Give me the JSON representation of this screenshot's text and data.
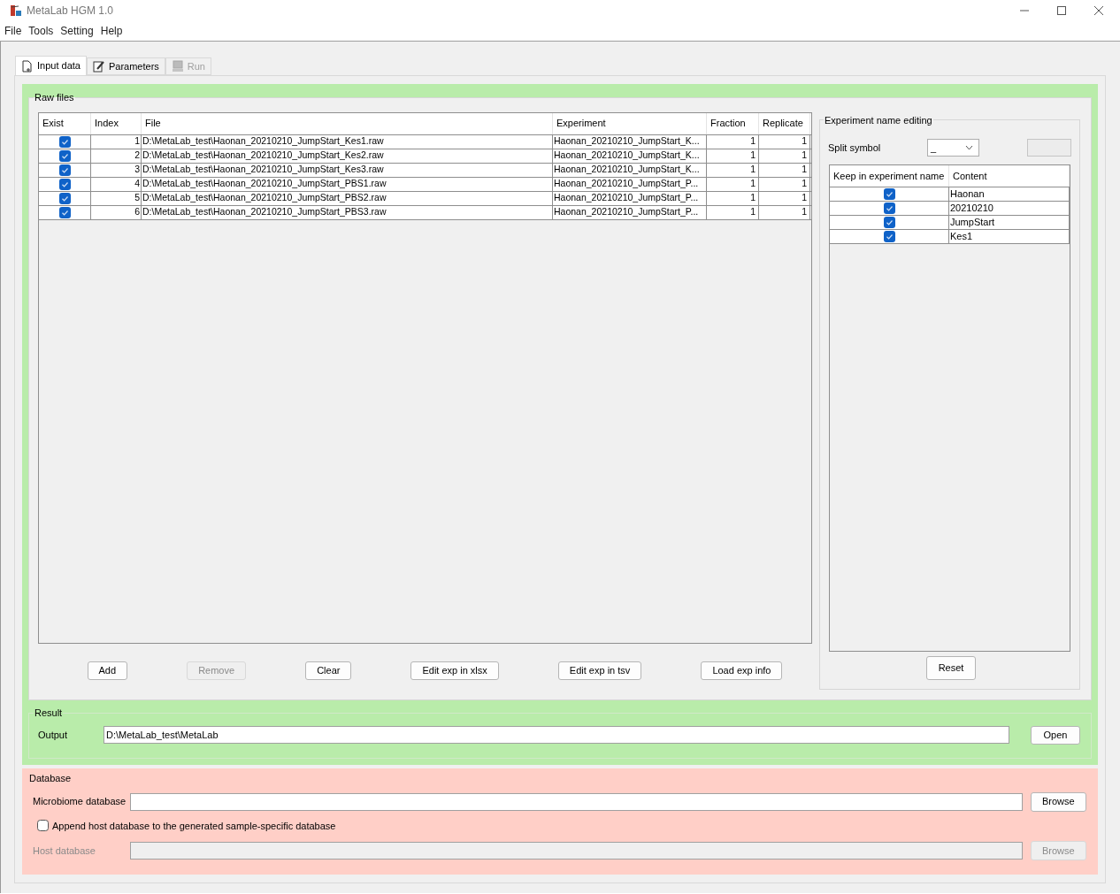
{
  "window": {
    "title": "MetaLab HGM 1.0"
  },
  "menu": [
    "File",
    "Tools",
    "Setting",
    "Help"
  ],
  "tabs": [
    {
      "label": "Input data",
      "selected": true,
      "disabled": false
    },
    {
      "label": "Parameters",
      "selected": false,
      "disabled": false
    },
    {
      "label": "Run",
      "selected": false,
      "disabled": true
    }
  ],
  "raw_files": {
    "title": "Raw files",
    "columns": [
      "Exist",
      "Index",
      "File",
      "Experiment",
      "Fraction",
      "Replicate"
    ],
    "rows": [
      {
        "exist": true,
        "index": "1",
        "file": "D:\\MetaLab_test\\Haonan_20210210_JumpStart_Kes1.raw",
        "experiment": "Haonan_20210210_JumpStart_K...",
        "fraction": "1",
        "replicate": "1"
      },
      {
        "exist": true,
        "index": "2",
        "file": "D:\\MetaLab_test\\Haonan_20210210_JumpStart_Kes2.raw",
        "experiment": "Haonan_20210210_JumpStart_K...",
        "fraction": "1",
        "replicate": "1"
      },
      {
        "exist": true,
        "index": "3",
        "file": "D:\\MetaLab_test\\Haonan_20210210_JumpStart_Kes3.raw",
        "experiment": "Haonan_20210210_JumpStart_K...",
        "fraction": "1",
        "replicate": "1"
      },
      {
        "exist": true,
        "index": "4",
        "file": "D:\\MetaLab_test\\Haonan_20210210_JumpStart_PBS1.raw",
        "experiment": "Haonan_20210210_JumpStart_P...",
        "fraction": "1",
        "replicate": "1"
      },
      {
        "exist": true,
        "index": "5",
        "file": "D:\\MetaLab_test\\Haonan_20210210_JumpStart_PBS2.raw",
        "experiment": "Haonan_20210210_JumpStart_P...",
        "fraction": "1",
        "replicate": "1"
      },
      {
        "exist": true,
        "index": "6",
        "file": "D:\\MetaLab_test\\Haonan_20210210_JumpStart_PBS3.raw",
        "experiment": "Haonan_20210210_JumpStart_P...",
        "fraction": "1",
        "replicate": "1"
      }
    ],
    "buttons": [
      {
        "label": "Add",
        "disabled": false
      },
      {
        "label": "Remove",
        "disabled": true
      },
      {
        "label": "Clear",
        "disabled": false
      },
      {
        "label": "Edit exp in xlsx",
        "disabled": false
      },
      {
        "label": "Edit exp in tsv",
        "disabled": false
      },
      {
        "label": "Load exp info",
        "disabled": false
      }
    ]
  },
  "experiment_name_editing": {
    "title": "Experiment name editing",
    "split_symbol_label": "Split symbol",
    "split_symbol_value": "_",
    "columns": [
      "Keep in experiment name",
      "Content"
    ],
    "rows": [
      {
        "keep": true,
        "content": "Haonan"
      },
      {
        "keep": true,
        "content": "20210210"
      },
      {
        "keep": true,
        "content": "JumpStart"
      },
      {
        "keep": true,
        "content": "Kes1"
      }
    ],
    "reset_button": "Reset"
  },
  "result": {
    "title": "Result",
    "output_label": "Output",
    "output_value": "D:\\MetaLab_test\\MetaLab",
    "open_button": "Open"
  },
  "database": {
    "title": "Database",
    "microbiome_label": "Microbiome database",
    "microbiome_browse": "Browse",
    "append": {
      "label": "Append host database to the generated sample-specific database",
      "checked": false
    },
    "host_label": "Host database",
    "host_disabled": true,
    "host_browse": "Browse"
  }
}
